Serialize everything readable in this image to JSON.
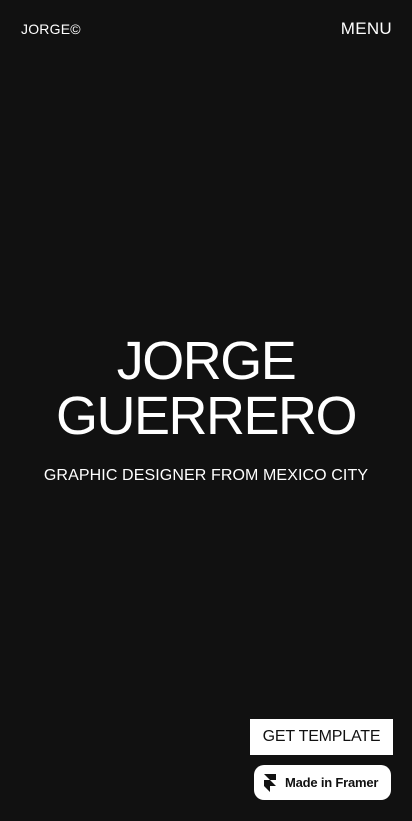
{
  "header": {
    "logo_text": "JORGE©",
    "menu_label": "MENU"
  },
  "hero": {
    "title_line1": "JORGE",
    "title_line2": "GUERRERO",
    "subtitle": "GRAPHIC DESIGNER FROM MEXICO CITY"
  },
  "cta": {
    "get_template_label": "GET TEMPLATE"
  },
  "badge": {
    "label": "Made in Framer",
    "icon": "framer-logo-icon"
  },
  "colors": {
    "background": "#111111",
    "text": "#ffffff",
    "button_bg": "#ffffff",
    "button_text": "#111111"
  }
}
